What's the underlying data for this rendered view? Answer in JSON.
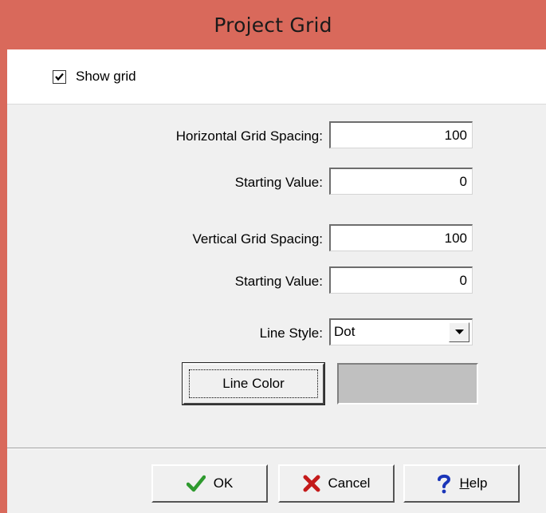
{
  "window": {
    "title": "Project Grid",
    "accent_color": "#d9695b"
  },
  "show_grid": {
    "label": "Show grid",
    "checked": true
  },
  "fields": {
    "horizontal_spacing": {
      "label": "Horizontal Grid Spacing:",
      "value": "100"
    },
    "horizontal_start": {
      "label": "Starting Value:",
      "value": "0"
    },
    "vertical_spacing": {
      "label": "Vertical Grid Spacing:",
      "value": "100"
    },
    "vertical_start": {
      "label": "Starting Value:",
      "value": "0"
    }
  },
  "line_style": {
    "label": "Line Style:",
    "value": "Dot"
  },
  "line_color": {
    "button_label": "Line Color",
    "swatch_color": "#c0c0c0"
  },
  "buttons": {
    "ok": {
      "label": "OK",
      "icon": "checkmark-icon"
    },
    "cancel": {
      "label": "Cancel",
      "icon": "x-icon"
    },
    "help": {
      "label_prefix": "",
      "label_underlined": "H",
      "label_rest": "elp",
      "icon": "question-mark-icon"
    }
  }
}
